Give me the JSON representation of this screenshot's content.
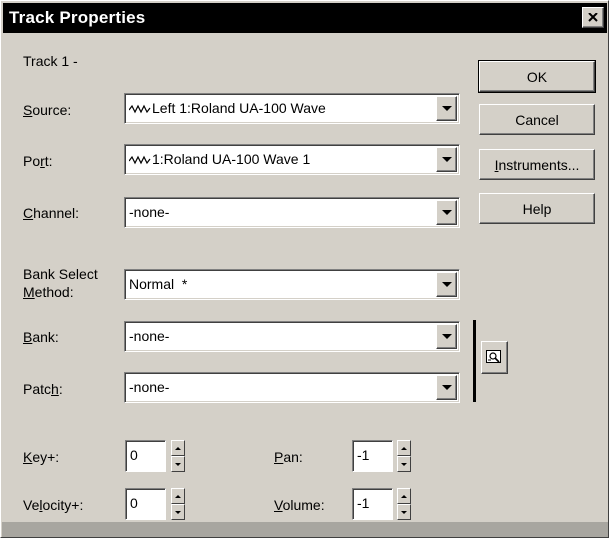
{
  "window": {
    "title": "Track Properties"
  },
  "header": {
    "track_label": "Track 1 -"
  },
  "fields": {
    "source": {
      "label_u": "S",
      "label_rest": "ource:",
      "value": "Left 1:Roland UA-100 Wave"
    },
    "port": {
      "label_pre": "Po",
      "label_u": "r",
      "label_rest": "t:",
      "value": "1:Roland UA-100 Wave 1"
    },
    "channel": {
      "label_u": "C",
      "label_rest": "hannel:",
      "value": "-none-"
    },
    "bank_select": {
      "label_line1": "Bank Select",
      "label_u": "M",
      "label_rest": "ethod:",
      "value": "Normal  *"
    },
    "bank": {
      "label_u": "B",
      "label_rest": "ank:",
      "value": "-none-"
    },
    "patch": {
      "label_pre": "Patc",
      "label_u": "h",
      "label_rest": ":",
      "value": "-none-"
    }
  },
  "spinners": {
    "key": {
      "label_u": "K",
      "label_rest": "ey+:",
      "value": "0"
    },
    "velocity": {
      "label_pre": "Ve",
      "label_u": "l",
      "label_rest": "ocity+:",
      "value": "0"
    },
    "pan": {
      "label_u": "P",
      "label_rest": "an:",
      "value": "-1"
    },
    "volume": {
      "label_u": "V",
      "label_rest": "olume:",
      "value": "-1"
    }
  },
  "buttons": {
    "ok": "OK",
    "cancel": "Cancel",
    "instruments_u": "I",
    "instruments_rest": "nstruments...",
    "help": "Help"
  },
  "icons": {
    "close": "close-icon",
    "wave": "wave-icon",
    "dropdown": "chevron-down-icon",
    "patch_browse": "patch-browser-icon"
  }
}
